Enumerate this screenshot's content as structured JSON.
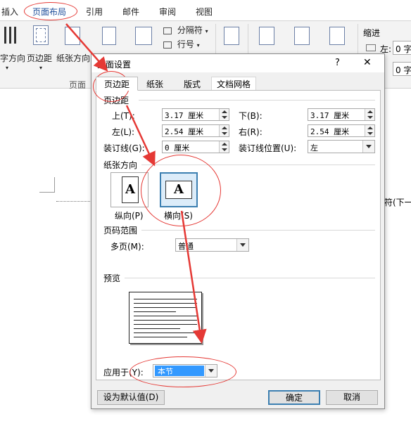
{
  "ribbon": {
    "tabs": [
      "插入",
      "页面布局",
      "引用",
      "邮件",
      "审阅",
      "视图"
    ],
    "active_tab": "页面布局",
    "buttons": {
      "text_direction": "字方向",
      "margins": "页边距",
      "orientation": "纸张方向",
      "breaks": "分隔符",
      "line_numbers": "行号",
      "indent_header": "缩进",
      "indent_left_label": "左:",
      "indent_left_value": "0 字",
      "indent_right_value": "0 字",
      "group_label": "页面"
    }
  },
  "document": {
    "text_fragment": "符(下一"
  },
  "dialog": {
    "title": "页面设置",
    "help": "?",
    "close": "✕",
    "tabs": [
      "页边距",
      "纸张",
      "版式",
      "文档网格"
    ],
    "active_tab": "页边距",
    "margins_section": "页边距",
    "fields": {
      "top_label": "上(T):",
      "top_value": "3.17 厘米",
      "bottom_label": "下(B):",
      "bottom_value": "3.17 厘米",
      "left_label": "左(L):",
      "left_value": "2.54 厘米",
      "right_label": "右(R):",
      "right_value": "2.54 厘米",
      "gutter_label": "装订线(G):",
      "gutter_value": "0 厘米",
      "gutter_pos_label": "装订线位置(U):",
      "gutter_pos_value": "左"
    },
    "orientation_section": "纸张方向",
    "portrait_label": "纵向(P)",
    "landscape_label": "横向(S)",
    "orientation_glyph": "A",
    "pages_section": "页码范围",
    "multiple_pages_label": "多页(M):",
    "multiple_pages_value": "普通",
    "preview_section": "预览",
    "apply_to_label": "应用于(Y):",
    "apply_to_value": "本节",
    "default_button": "设为默认值(D)",
    "ok_button": "确定",
    "cancel_button": "取消"
  },
  "colors": {
    "annotation": "#e53935",
    "selection": "#3399ff",
    "accent_border": "#3c7fb1"
  }
}
